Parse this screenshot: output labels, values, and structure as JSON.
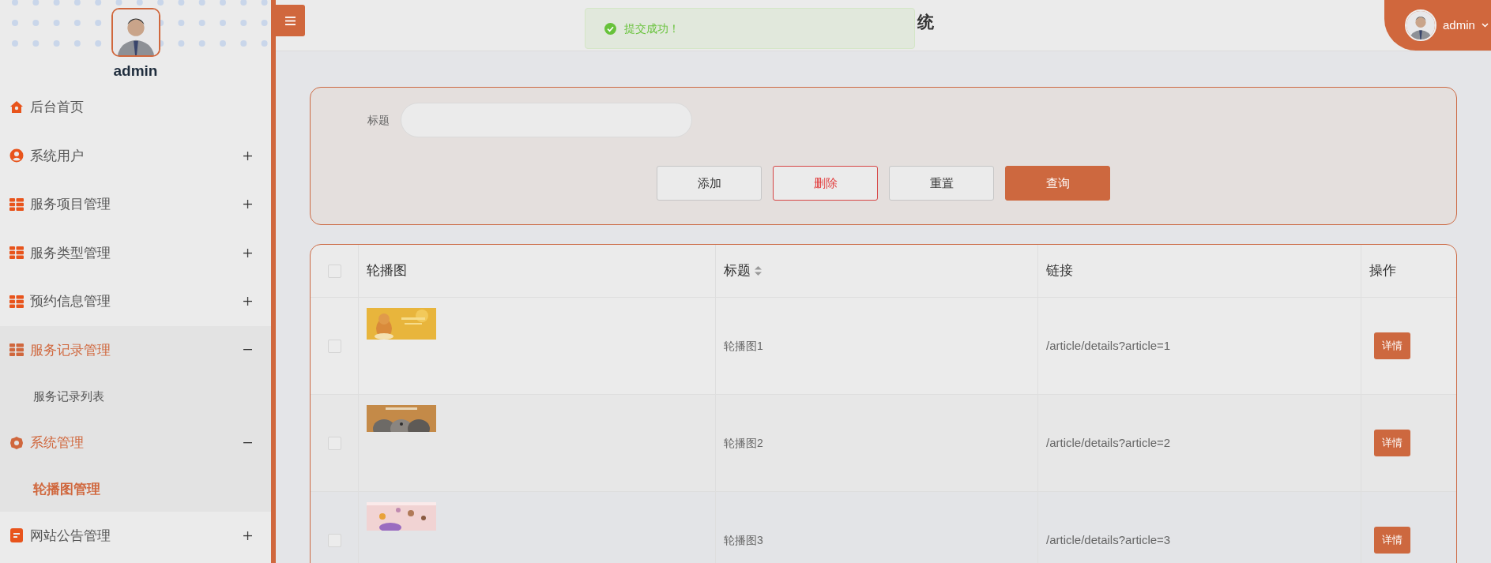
{
  "sidebar": {
    "user_name": "admin",
    "menu": [
      {
        "kind": "link",
        "label": "后台首页"
      },
      {
        "kind": "group",
        "label": "系统用户",
        "expanded": false
      },
      {
        "kind": "group",
        "label": "服务项目管理",
        "expanded": false
      },
      {
        "kind": "group",
        "label": "服务类型管理",
        "expanded": false
      },
      {
        "kind": "group",
        "label": "预约信息管理",
        "expanded": false
      },
      {
        "kind": "group",
        "label": "服务记录管理",
        "expanded": true,
        "children": [
          {
            "label": "服务记录列表",
            "selected": false
          }
        ]
      },
      {
        "kind": "group",
        "label": "系统管理",
        "expanded": true,
        "children": [
          {
            "label": "轮播图管理",
            "selected": true
          }
        ]
      },
      {
        "kind": "group",
        "label": "网站公告管理",
        "expanded": false
      }
    ]
  },
  "header": {
    "title": "统",
    "user_name": "admin"
  },
  "toast": {
    "kind": "success",
    "message": "提交成功！"
  },
  "search": {
    "fields": [
      {
        "label": "标题"
      }
    ],
    "buttons": [
      {
        "kind": "default",
        "label": "添加"
      },
      {
        "kind": "danger",
        "label": "删除"
      },
      {
        "kind": "default",
        "label": "重置"
      },
      {
        "kind": "primary",
        "label": "查询"
      }
    ]
  },
  "table": {
    "select_all": {
      "checked": false
    },
    "columns": [
      {
        "label": "轮播图",
        "sortable": false
      },
      {
        "label": "标题",
        "sortable": true
      },
      {
        "label": "链接",
        "sortable": false
      },
      {
        "label": "操作",
        "sortable": false
      }
    ],
    "rows": [
      {
        "checked": false,
        "title": "轮播图1",
        "link": "/article/details?article=1",
        "action": "详情"
      },
      {
        "checked": false,
        "title": "轮播图2",
        "link": "/article/details?article=2",
        "action": "详情"
      },
      {
        "checked": false,
        "title": "轮播图3",
        "link": "/article/details?article=3",
        "action": "详情"
      }
    ]
  }
}
